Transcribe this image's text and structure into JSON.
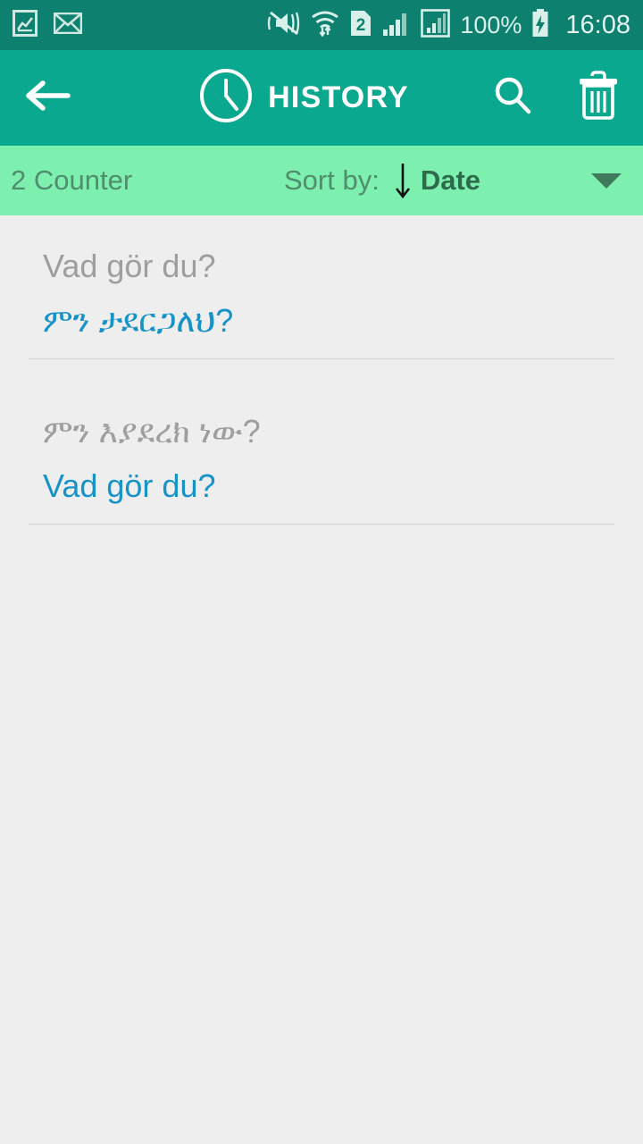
{
  "status_bar": {
    "background": "#0d8070",
    "left_icons": [
      {
        "name": "photo-icon",
        "label": "image"
      },
      {
        "name": "mail-icon",
        "label": "envelope"
      }
    ],
    "right_icons": [
      {
        "name": "mute-vibrate-icon",
        "label": "silent"
      },
      {
        "name": "wifi-transfer-icon",
        "label": "wifi"
      },
      {
        "name": "sim-card-icon",
        "label": "2"
      },
      {
        "name": "signal-bars-icon",
        "label": "signal1"
      },
      {
        "name": "signal-bars-boxed-icon",
        "label": "signal2"
      }
    ],
    "battery_percent": "100%",
    "battery_icon": "battery-charging-icon",
    "time": "16:08"
  },
  "action_bar": {
    "background": "#0aa88f",
    "back_icon": "back-arrow-icon",
    "clock_icon": "clock-icon",
    "title": "HISTORY",
    "search_icon": "search-icon",
    "delete_icon": "trash-icon"
  },
  "sort_bar": {
    "background": "#7df0b0",
    "counter": "2 Counter",
    "sort_label": "Sort by:",
    "sort_direction_icon": "arrow-down-icon",
    "sort_value": "Date",
    "dropdown_icon": "caret-down-icon"
  },
  "history": {
    "items": [
      {
        "source_text": "Vad gör du?",
        "target_text": "ምን ታደርጋለህ?"
      },
      {
        "source_text": "ምን እያደረክ ነው?",
        "target_text": "Vad gör du?"
      }
    ]
  },
  "colors": {
    "status_bar": "#0d8070",
    "action_bar": "#0aa88f",
    "sort_bar": "#7df0b0",
    "page_background": "#eeeeee",
    "source_text": "#9e9e9e",
    "target_text": "#1793c7",
    "counter_text": "#4f8d6d",
    "sort_value_text": "#2e6b4b"
  }
}
